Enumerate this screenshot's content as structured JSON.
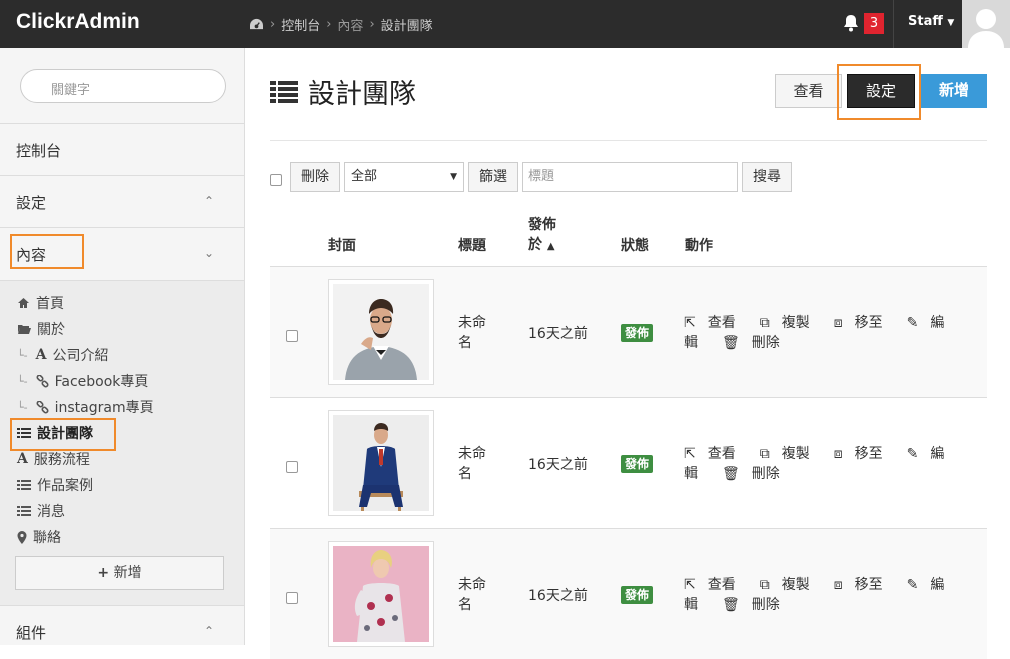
{
  "brand": "ClickrAdmin",
  "breadcrumb": [
    "控制台",
    "內容",
    "設計團隊"
  ],
  "notifications": "3",
  "user": "Staff",
  "sidebar": {
    "search_placeholder": "關鍵字",
    "sections": [
      "控制台",
      "設定",
      "內容",
      "組件"
    ],
    "items": [
      "首頁",
      "關於",
      "公司介紹",
      "Facebook專頁",
      "instagram專頁",
      "設計團隊",
      "服務流程",
      "作品案例",
      "消息",
      "聯絡"
    ],
    "add_label": "新增"
  },
  "page": {
    "title": "設計團隊",
    "view_label": "查看",
    "settings_label": "設定",
    "new_label": "新增"
  },
  "toolbar": {
    "delete_label": "刪除",
    "filter_value": "全部",
    "filter_label": "篩選",
    "title_placeholder": "標題",
    "search_label": "搜尋"
  },
  "table": {
    "headers": [
      "封面",
      "標題",
      "發佈於",
      "狀態",
      "動作"
    ],
    "rows": [
      {
        "title": "未命名",
        "published": "16天之前",
        "status": "發佈",
        "actions": [
          "查看",
          "複製",
          "移至",
          "編輯",
          "刪除"
        ]
      },
      {
        "title": "未命名",
        "published": "16天之前",
        "status": "發佈",
        "actions": [
          "查看",
          "複製",
          "移至",
          "編輯",
          "刪除"
        ]
      },
      {
        "title": "未命名",
        "published": "16天之前",
        "status": "發佈",
        "actions": [
          "查看",
          "複製",
          "移至",
          "編輯",
          "刪除"
        ]
      }
    ]
  },
  "colors": {
    "topbar": "#2c2c2c",
    "primary": "#3a9ad9",
    "dark_button": "#2b2b2b",
    "status_green": "#3e8e41",
    "badge_red": "#e0242f",
    "highlight": "#f08a2b"
  }
}
